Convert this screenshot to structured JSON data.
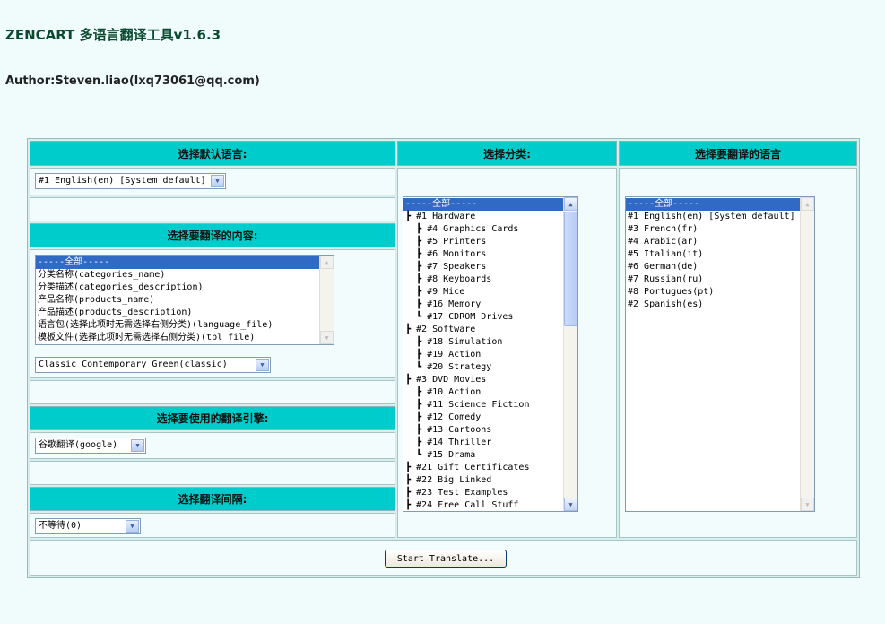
{
  "header": {
    "title": "ZENCART 多语言翻译工具v1.6.3",
    "author": "Author:Steven.liao(lxq73061@qq.com)"
  },
  "left": {
    "default_lang_header": "选择默认语言:",
    "default_lang_value": "#1 English(en) [System default]",
    "content_header": "选择要翻译的内容:",
    "content_options": [
      "-----全部-----",
      "分类名称(categories_name)",
      "分类描述(categories_description)",
      "产品名称(products_name)",
      "产品描述(products_description)",
      "语言包(选择此项时无需选择右侧分类)(language_file)",
      "模板文件(选择此项时无需选择右侧分类)(tpl_file)"
    ],
    "template_value": "Classic Contemporary Green(classic)",
    "engine_header": "选择要使用的翻译引擎:",
    "engine_value": "谷歌翻译(google)",
    "interval_header": "选择翻译间隔:",
    "interval_value": "不等待(0)"
  },
  "middle": {
    "header": "选择分类:",
    "categories": [
      "-----全部-----",
      "┣ #1 Hardware",
      "  ┣ #4 Graphics Cards",
      "  ┣ #5 Printers",
      "  ┣ #6 Monitors",
      "  ┣ #7 Speakers",
      "  ┣ #8 Keyboards",
      "  ┣ #9 Mice",
      "  ┣ #16 Memory",
      "  ┗ #17 CDROM Drives",
      "┣ #2 Software",
      "  ┣ #18 Simulation",
      "  ┣ #19 Action",
      "  ┗ #20 Strategy",
      "┣ #3 DVD Movies",
      "  ┣ #10 Action",
      "  ┣ #11 Science Fiction",
      "  ┣ #12 Comedy",
      "  ┣ #13 Cartoons",
      "  ┣ #14 Thriller",
      "  ┗ #15 Drama",
      "┣ #21 Gift Certificates",
      "┣ #22 Big Linked",
      "┣ #23 Test Examples",
      "┣ #24 Free Call Stuff"
    ]
  },
  "right": {
    "header": "选择要翻译的语言",
    "languages": [
      "-----全部-----",
      "#1 English(en) [System default]",
      "#3 French(fr)",
      "#4 Arabic(ar)",
      "#5 Italian(it)",
      "#6 German(de)",
      "#7 Russian(ru)",
      "#8 Portugues(pt)",
      "#2 Spanish(es)"
    ]
  },
  "footer": {
    "start_button": "Start Translate..."
  },
  "icons": {
    "dropdown": "chevron-down-icon",
    "scroll_up": "chevron-up-icon",
    "scroll_down": "chevron-down-icon"
  },
  "colors": {
    "header_bg": "#00cccc",
    "selected_bg": "#316ac5",
    "title": "#0b4a30"
  }
}
